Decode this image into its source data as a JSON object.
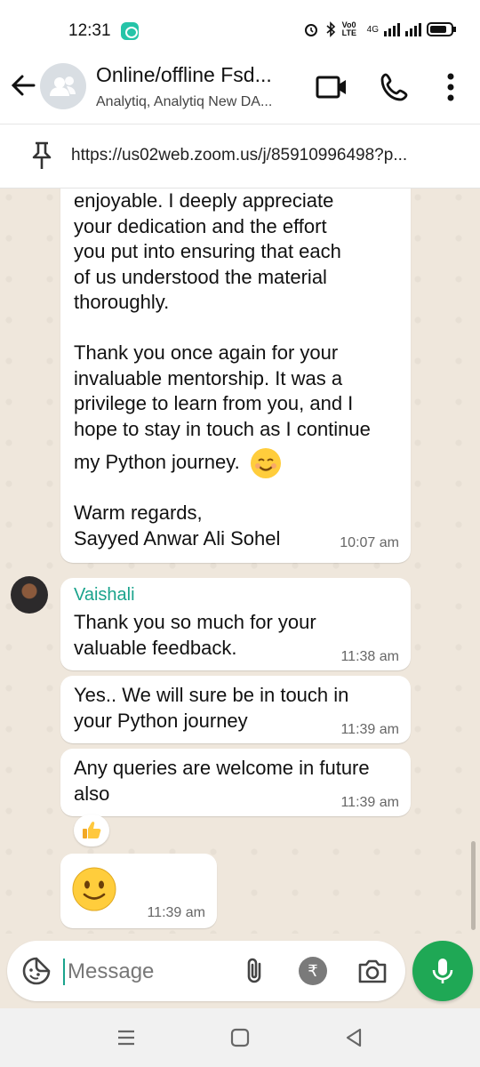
{
  "status_bar": {
    "time": "12:31",
    "network_label": "4G",
    "volte_label": "Vo0 LTE"
  },
  "header": {
    "title": "Online/offline Fsd...",
    "subtitle": "Analytiq, Analytiq New DA..."
  },
  "pinned": {
    "text": "https://us02web.zoom.us/j/85910996498?p..."
  },
  "messages": [
    {
      "text": "enjoyable. I deeply appreciate\nyour dedication and the effort\nyou put into ensuring that each\nof us understood the material\nthoroughly.\n\nThank you once again for your\ninvaluable mentorship. It was a\nprivilege to learn from you, and I\nhope to stay in touch as I continue",
      "last_line": "my Python journey.",
      "emoji": "smiling-face-with-smiling-eyes",
      "signoff": "Warm regards,\nSayyed Anwar Ali Sohel",
      "time": "10:07 am"
    },
    {
      "sender": "Vaishali",
      "text": "Thank you so much for your\nvaluable feedback.",
      "time": "11:38 am"
    },
    {
      "text": "Yes.. We will sure be in touch  in\nyour Python journey",
      "time": "11:39 am"
    },
    {
      "text": "Any queries are welcome in future\nalso",
      "time": "11:39 am",
      "reaction": "thumbs-up"
    },
    {
      "emoji": "slightly-smiling-face",
      "time": "11:39 am"
    }
  ],
  "composer": {
    "placeholder": "Message",
    "payment_symbol": "₹"
  },
  "colors": {
    "accent_green": "#1fa855",
    "sender_teal": "#1aa38c",
    "chat_background": "#efe7dc",
    "bubble": "#ffffff"
  },
  "icons": [
    "back-arrow-icon",
    "group-avatar-icon",
    "video-call-icon",
    "phone-icon",
    "more-options-icon",
    "pin-icon",
    "sticker-icon",
    "paperclip-icon",
    "rupee-icon",
    "camera-icon",
    "mic-icon",
    "thumbs-up-icon",
    "recents-icon",
    "home-icon",
    "back-triangle-icon"
  ]
}
